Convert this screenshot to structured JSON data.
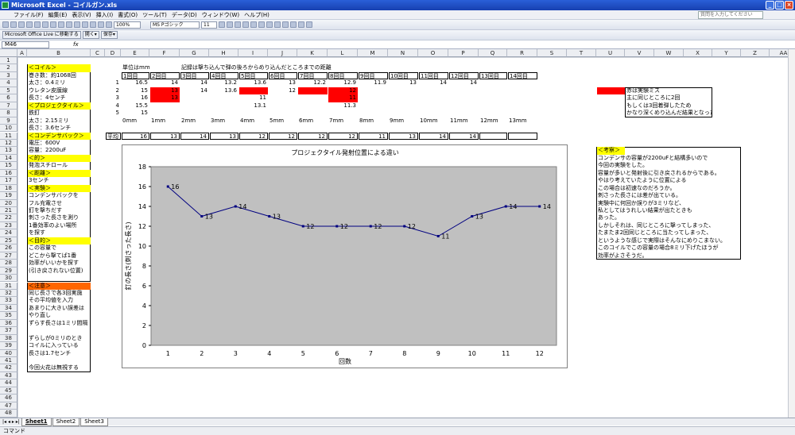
{
  "window": {
    "title": "Microsoft Excel - コイルガン.xls",
    "help_placeholder": "質問を入力してください"
  },
  "menu": [
    "ファイル(F)",
    "編集(E)",
    "表示(V)",
    "挿入(I)",
    "書式(O)",
    "ツール(T)",
    "データ(D)",
    "ウィンドウ(W)",
    "ヘルプ(H)"
  ],
  "toolbar": {
    "zoom": "100%",
    "font": "MS Pゴシック",
    "size": "11",
    "office_live": "Microsoft Office Live に移動する",
    "open_btn": "開く▾",
    "save_btn": "保存▾"
  },
  "formula": {
    "name_box": "M46",
    "fx": "fx"
  },
  "columns": [
    "A",
    "B",
    "C",
    "D",
    "E",
    "F",
    "G",
    "H",
    "I",
    "J",
    "K",
    "L",
    "M",
    "N",
    "O",
    "P",
    "Q",
    "R",
    "S",
    "T",
    "U",
    "V",
    "W",
    "X",
    "Y",
    "Z",
    "AA"
  ],
  "rows": [
    "1",
    "2",
    "3",
    "4",
    "5",
    "6",
    "7",
    "8",
    "9",
    "10",
    "11",
    "12",
    "13",
    "14",
    "15",
    "16",
    "17",
    "18",
    "19",
    "20",
    "21",
    "22",
    "23",
    "24",
    "25",
    "26",
    "27",
    "28",
    "29",
    "30",
    "31",
    "32",
    "33",
    "34",
    "35",
    "36",
    "37",
    "38",
    "39",
    "40",
    "41",
    "42",
    "43",
    "44",
    "45",
    "46",
    "47",
    "48"
  ],
  "left_col": {
    "coil_head": "＜コイル＞",
    "coil": [
      "巻き数：約1068回",
      "太さ：0.4ミリ",
      "ウレタン皮膜線",
      "長さ：4センチ"
    ],
    "proj_head": "＜プロジェクタイル＞",
    "proj": [
      "鉄釘",
      "太さ：2.15ミリ",
      "長さ：3.6センチ"
    ],
    "cap_head": "＜コンデンサバック＞",
    "cap": [
      "電圧：600V",
      "容量：2200uF"
    ],
    "target_head": "＜的＞",
    "target": [
      "発泡スチロール"
    ],
    "dist_head": "＜距離＞",
    "dist": [
      "3センチ"
    ],
    "exp_head": "＜実験＞",
    "exp": [
      "コンデンサバックを",
      "フル充電させ",
      "釘を撃ちだす",
      "刺さった長さを測り",
      "1番効率のよい場所",
      "を探す"
    ],
    "purpose_head": "＜目的＞",
    "purpose": [
      "この容量で",
      "どこから撃てば1番",
      "効率がいいかを探す",
      "(引き戻されない位置)"
    ],
    "note_head": "＜注意＞",
    "note": [
      "同じ長さで各3回実施",
      "その平均値を入力",
      "あまりに大きい誤差は",
      "やり直し",
      "ずらす長さは1ミリ間隔",
      "",
      "ずらしが0ミリのとき",
      "コイルに入っている",
      "長さは1.7センチ",
      "",
      "今回火花は無視する"
    ]
  },
  "table": {
    "unit_note": "単位はmm",
    "record_note": "記録は撃ち込んで弾の後ろからめり込んだところまでの距離",
    "trial_headers": [
      "1回目",
      "2回目",
      "3回目",
      "4回目",
      "5回目",
      "6回目",
      "7回目",
      "8回目",
      "9回目",
      "10回目",
      "11回目",
      "12回目",
      "13回目",
      "14回目"
    ],
    "row_nums": [
      "1",
      "2",
      "3",
      "4",
      "5"
    ],
    "rows": [
      [
        "16.5",
        "14",
        "14",
        "13.2",
        "13.6",
        "13",
        "12.2",
        "12.9",
        "11.9",
        "13",
        "14",
        "14",
        "",
        ""
      ],
      [
        "15",
        "13",
        "14",
        "13.6",
        "",
        "12",
        "",
        "12",
        "",
        "",
        "",
        "",
        "",
        ""
      ],
      [
        "16",
        "13",
        "",
        "",
        "11",
        "",
        "",
        "11",
        "",
        "",
        "",
        "",
        "",
        ""
      ],
      [
        "15.5",
        "",
        "",
        "",
        "13.1",
        "",
        "",
        "11.3",
        "",
        "",
        "",
        "",
        "",
        ""
      ],
      [
        "15",
        "",
        "",
        "",
        "",
        "",
        "",
        "",
        "",
        "",
        "",
        "",
        "",
        ""
      ]
    ],
    "offsets": [
      "0mm",
      "1mm",
      "2mm",
      "3mm",
      "4mm",
      "5mm",
      "6mm",
      "7mm",
      "8mm",
      "9mm",
      "10mm",
      "11mm",
      "12mm",
      "13mm"
    ],
    "avg_label": "平均",
    "averages": [
      "16",
      "13",
      "14",
      "13",
      "12",
      "12",
      "12",
      "12",
      "11",
      "13",
      "14",
      "14",
      "",
      ""
    ]
  },
  "legend_note": {
    "text": "赤は実験ミス",
    "lines": [
      "主に同じところに2回",
      "もしくは3回着弾したため",
      "かなり深くめり込んだ結果となった"
    ],
    "color": "#ff0000"
  },
  "consider": {
    "head": "＜考察＞",
    "lines": [
      "コンデンサの容量が2200uFと結構多いので",
      "今回の実験をした。",
      "容量が多いと発射後に引き戻されるからである。",
      "やはり考えていたように位置による",
      "この場合は初速なのだろうか。",
      "刺さった長さには差が出ている。",
      "実験中に何回か誤りが3ミリなど、",
      "私としてはうれしい結果が出たときも",
      "あった。",
      "しかしそれは、同じところに撃ってしまった、",
      "たまたま2回同じところに当たってしまった、",
      "というような感じで実際はそんなにめりこまない。",
      "このコイルでこの容量の場合8ミリ下げたほうが",
      "効率がよさそうだ。"
    ]
  },
  "chart_data": {
    "type": "line",
    "title": "プロジェクタイル発射位置による違い",
    "xlabel": "回数",
    "ylabel": "釘の長さ(刺さった長さ)",
    "x": [
      1,
      2,
      3,
      4,
      5,
      6,
      7,
      8,
      9,
      10,
      11,
      12
    ],
    "series": [
      {
        "values": [
          16,
          13,
          14,
          13,
          12,
          12,
          12,
          12,
          11,
          13,
          14,
          14
        ]
      }
    ],
    "ylim": [
      0,
      18
    ],
    "yticks": [
      0,
      2,
      4,
      6,
      8,
      10,
      12,
      14,
      16,
      18
    ],
    "grid": false,
    "plot_bg": "#c0c0c0",
    "line_color": "#000080"
  },
  "sheets": [
    "Sheet1",
    "Sheet2",
    "Sheet3"
  ],
  "status": "コマンド"
}
